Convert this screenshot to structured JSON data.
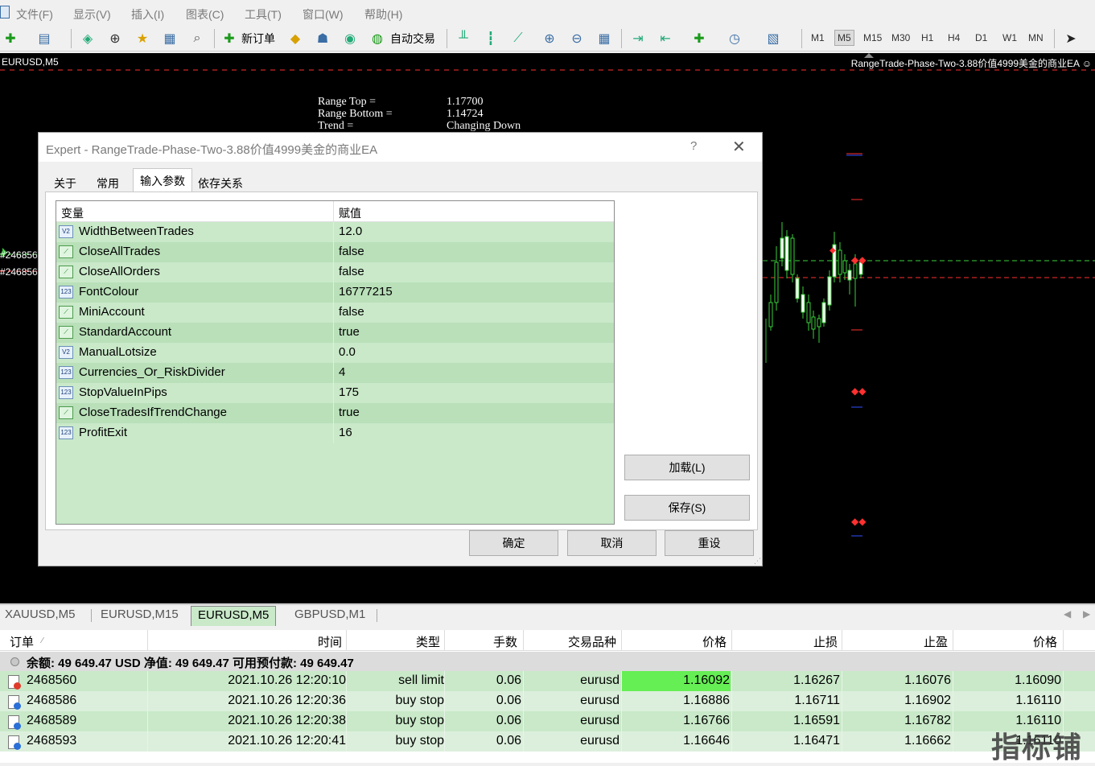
{
  "menu": {
    "items": [
      "文件(F)",
      "显示(V)",
      "插入(I)",
      "图表(C)",
      "工具(T)",
      "窗口(W)",
      "帮助(H)"
    ]
  },
  "toolbar": {
    "new_order": "新订单",
    "auto_trade": "自动交易",
    "timeframes": [
      "M1",
      "M5",
      "M15",
      "M30",
      "H1",
      "H4",
      "D1",
      "W1",
      "MN"
    ],
    "active_timeframe": "M5"
  },
  "chart": {
    "symbol_title": "EURUSD,M5",
    "ea_label": "RangeTrade-Phase-Two-3.88价值4999美金的商业EA",
    "ticket_tag_1": "#246856",
    "ticket_tag_2": "#246856",
    "info": [
      {
        "label": "Range Top =",
        "value": "1.17700"
      },
      {
        "label": "Range Bottom =",
        "value": "1.14724"
      },
      {
        "label": "Trend =",
        "value": "Changing Down"
      }
    ]
  },
  "dialog": {
    "title": "Expert - RangeTrade-Phase-Two-3.88价值4999美金的商业EA",
    "help": "?",
    "tabs": [
      "关于",
      "常用",
      "输入参数",
      "依存关系"
    ],
    "active_tab": "输入参数",
    "columns": {
      "variable": "变量",
      "value": "赋值"
    },
    "params": [
      {
        "name": "WidthBetweenTrades",
        "value": "12.0",
        "icon": "V2"
      },
      {
        "name": "CloseAllTrades",
        "value": "false",
        "icon": "bool"
      },
      {
        "name": "CloseAllOrders",
        "value": "false",
        "icon": "bool"
      },
      {
        "name": "FontColour",
        "value": "16777215",
        "icon": "123"
      },
      {
        "name": "MiniAccount",
        "value": "false",
        "icon": "bool"
      },
      {
        "name": "StandardAccount",
        "value": "true",
        "icon": "bool"
      },
      {
        "name": "ManualLotsize",
        "value": "0.0",
        "icon": "V2"
      },
      {
        "name": "Currencies_Or_RiskDivider",
        "value": "4",
        "icon": "123"
      },
      {
        "name": "StopValueInPips",
        "value": "175",
        "icon": "123"
      },
      {
        "name": "CloseTradesIfTrendChange",
        "value": "true",
        "icon": "bool"
      },
      {
        "name": "ProfitExit",
        "value": "16",
        "icon": "123"
      }
    ],
    "load_label": "加载(L)",
    "save_label": "保存(S)",
    "ok_label": "确定",
    "cancel_label": "取消",
    "reset_label": "重设"
  },
  "chart_tabs": [
    "XAUUSD,M5",
    "EURUSD,M15",
    "EURUSD,M5",
    "GBPUSD,M1"
  ],
  "active_chart_tab": "EURUSD,M5",
  "orders": {
    "columns": [
      "订单",
      "时间",
      "类型",
      "手数",
      "交易品种",
      "价格",
      "止损",
      "止盈",
      "价格"
    ],
    "balance": "余额: 49 649.47 USD  净值: 49 649.47  可用预付款: 49 649.47",
    "rows": [
      {
        "ticket": "2468560",
        "time": "2021.10.26 12:20:10",
        "type": "sell limit",
        "lots": "0.06",
        "symbol": "eurusd",
        "price": "1.16092",
        "sl": "1.16267",
        "tp": "1.16076",
        "cur": "1.16090",
        "color": "#e03a2a"
      },
      {
        "ticket": "2468586",
        "time": "2021.10.26 12:20:36",
        "type": "buy stop",
        "lots": "0.06",
        "symbol": "eurusd",
        "price": "1.16886",
        "sl": "1.16711",
        "tp": "1.16902",
        "cur": "1.16110",
        "color": "#2a6fd8"
      },
      {
        "ticket": "2468589",
        "time": "2021.10.26 12:20:38",
        "type": "buy stop",
        "lots": "0.06",
        "symbol": "eurusd",
        "price": "1.16766",
        "sl": "1.16591",
        "tp": "1.16782",
        "cur": "1.16110",
        "color": "#2a6fd8"
      },
      {
        "ticket": "2468593",
        "time": "2021.10.26 12:20:41",
        "type": "buy stop",
        "lots": "0.06",
        "symbol": "eurusd",
        "price": "1.16646",
        "sl": "1.16471",
        "tp": "1.16662",
        "cur": "1.16110",
        "color": "#2a6fd8"
      }
    ]
  },
  "watermark": "指标铺"
}
